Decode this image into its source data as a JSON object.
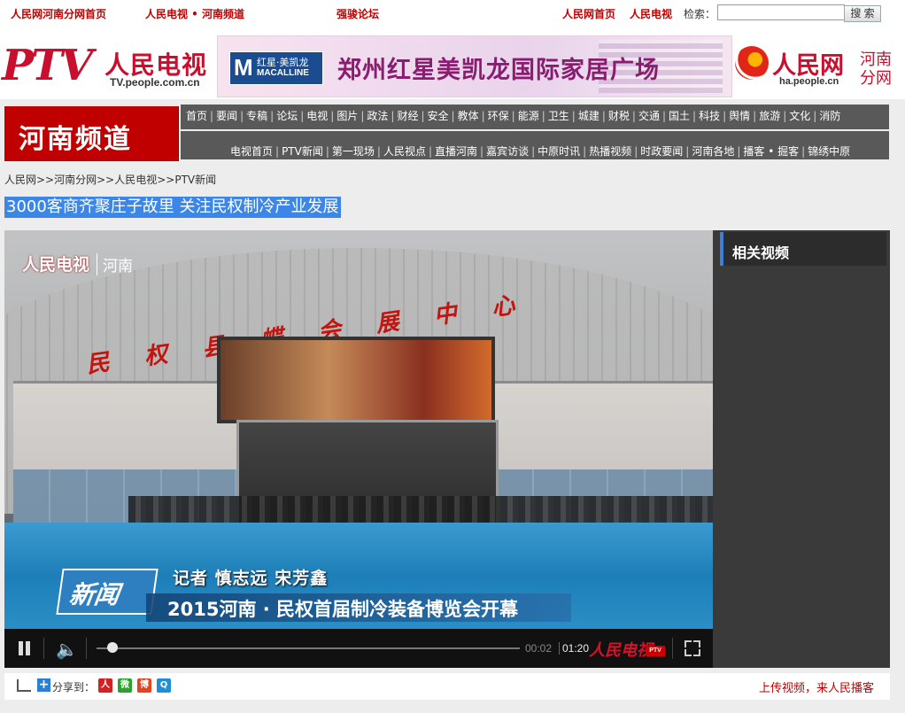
{
  "topbar": {
    "links_left": [
      "人民网河南分网首页",
      "人民电视 • 河南频道",
      "强骏论坛"
    ],
    "links_right": [
      "人民网首页",
      "人民电视"
    ],
    "search_label": "检索：",
    "search_value": "",
    "search_button": "搜 索"
  },
  "banner": {
    "ptv_logo": "PTV",
    "ptv_cn": "人民电视",
    "ptv_url": "TV.people.com.cn",
    "ad_logo_letter": "M",
    "ad_logo_cn": "红星·美凯龙",
    "ad_logo_en": "MACALLINE",
    "ad_text": "郑州红星美凯龙国际家居广场",
    "people_logo": "人民网",
    "people_url": "ha.people.cn",
    "henan_label_1": "河南",
    "henan_label_2": "分网"
  },
  "nav": {
    "brand": "河南频道",
    "row1": [
      "首页",
      "要闻",
      "专稿",
      "论坛",
      "电视",
      "图片",
      "政法",
      "财经",
      "安全",
      "教体",
      "环保",
      "能源",
      "卫生",
      "城建",
      "财税",
      "交通",
      "国土",
      "科技",
      "舆情",
      "旅游",
      "文化",
      "消防"
    ],
    "row2": [
      "电视首页",
      "PTV新闻",
      "第一现场",
      "人民视点",
      "直播河南",
      "嘉宾访谈",
      "中原时讯",
      "热播视频",
      "时政要闻",
      "河南各地",
      "播客 • 掘客",
      "锦绣中原"
    ]
  },
  "breadcrumb": "人民网>>河南分网>>人民电视>>PTV新闻",
  "article": {
    "title": "3000客商齐聚庄子故里 关注民权制冷产业发展"
  },
  "player": {
    "watermark_cn": "人民电视",
    "watermark_region": "河南",
    "sign_text": "民权县蝶会展中心",
    "news_tag": "新闻",
    "reporter": "记者  慎志远  宋芳鑫",
    "caption": "2015河南 · 民权首届制冷装备博览会开幕",
    "time_current": "00:02",
    "time_total": "01:20",
    "progress": 0.025,
    "player_logo": "人民电视",
    "player_badge": "PTV"
  },
  "related": {
    "title": "相关视频"
  },
  "share": {
    "label": "分享到：",
    "upload_link": "上传视频，来人民播客",
    "buttons": [
      {
        "glyph": "人",
        "color": "#d42020"
      },
      {
        "glyph": "微",
        "color": "#2aa32a"
      },
      {
        "glyph": "博",
        "color": "#e8431f"
      },
      {
        "glyph": "Q",
        "color": "#1c8fd6"
      }
    ]
  },
  "colors": {
    "brand_red": "#c00000",
    "nav_gray": "#595959",
    "highlight_blue": "#3b86e6"
  }
}
